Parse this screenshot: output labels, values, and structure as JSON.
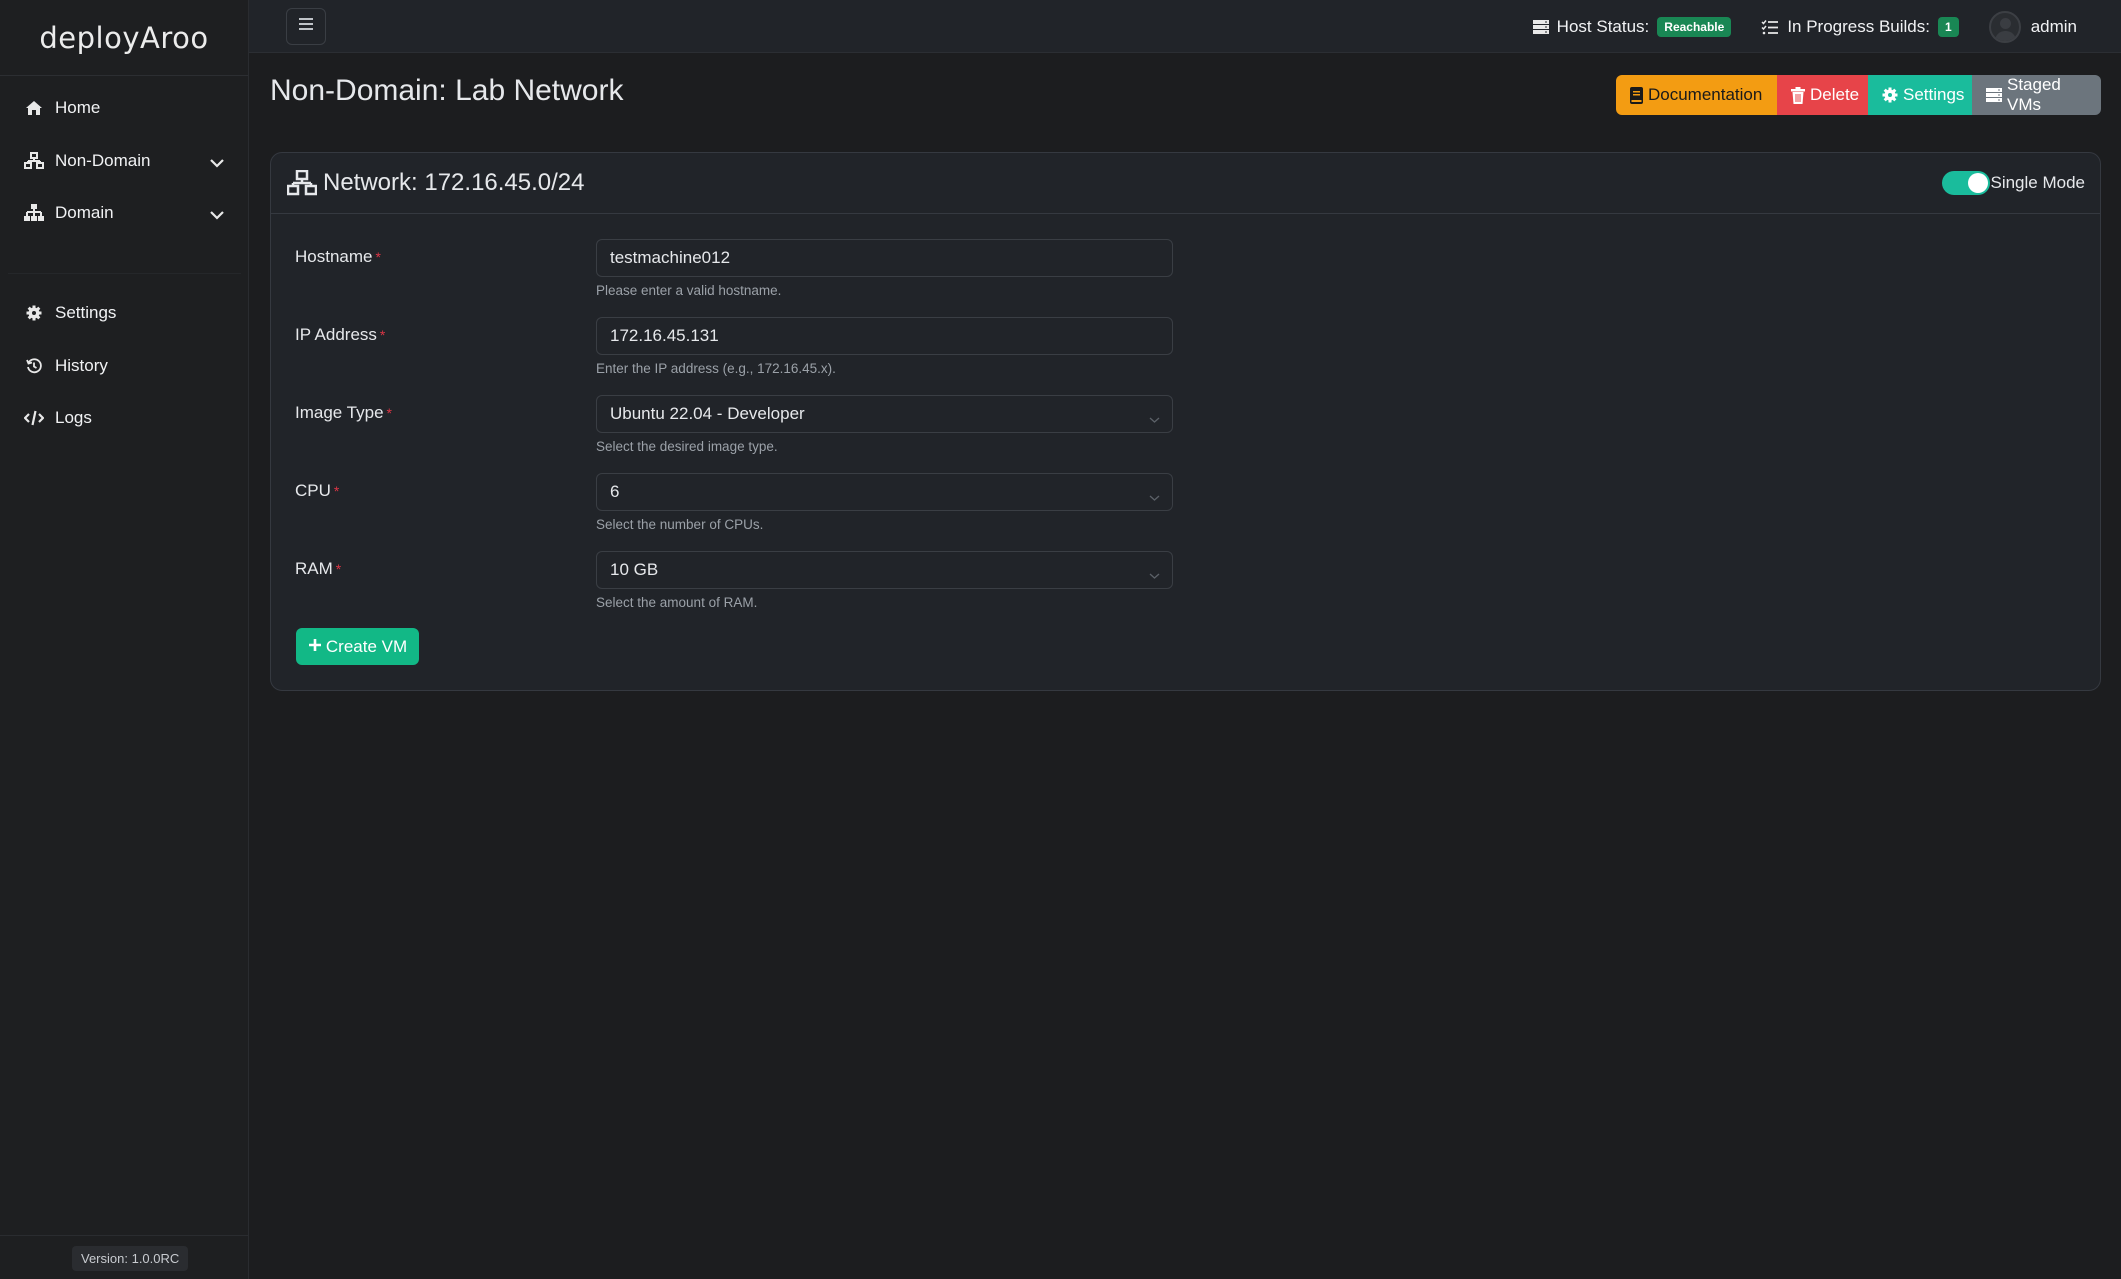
{
  "app": {
    "logo": "deployAroo",
    "version": "Version: 1.0.0RC"
  },
  "sidebar": {
    "items": [
      {
        "label": "Home",
        "icon": "home-icon"
      },
      {
        "label": "Non-Domain",
        "icon": "network-icon",
        "expandable": true
      },
      {
        "label": "Domain",
        "icon": "sitemap-icon",
        "expandable": true
      },
      {
        "label": "Settings",
        "icon": "gear-icon"
      },
      {
        "label": "History",
        "icon": "history-icon"
      },
      {
        "label": "Logs",
        "icon": "code-icon"
      }
    ]
  },
  "topbar": {
    "host_status_label": "Host Status:",
    "host_status_value": "Reachable",
    "builds_label": "In Progress Builds:",
    "builds_count": "1",
    "user": "admin"
  },
  "page": {
    "title": "Non-Domain: Lab Network",
    "actions": {
      "documentation": "Documentation",
      "delete": "Delete",
      "settings": "Settings",
      "staged_vms": "Staged VMs"
    }
  },
  "card": {
    "title": "Network: 172.16.45.0/24",
    "toggle_label": "Single Mode",
    "toggle_on": true,
    "fields": [
      {
        "label": "Hostname",
        "required": "*",
        "value": "testmachine012",
        "help": "Please enter a valid hostname.",
        "type": "text"
      },
      {
        "label": "IP Address",
        "required": "*",
        "value": "172.16.45.131",
        "help": "Enter the IP address (e.g., 172.16.45.x).",
        "type": "text"
      },
      {
        "label": "Image Type",
        "required": "*",
        "value": "Ubuntu 22.04 - Developer",
        "help": "Select the desired image type.",
        "type": "select"
      },
      {
        "label": "CPU",
        "required": "*",
        "value": "6",
        "help": "Select the number of CPUs.",
        "type": "select"
      },
      {
        "label": "RAM",
        "required": "*",
        "value": "10 GB",
        "help": "Select the amount of RAM.",
        "type": "select"
      }
    ],
    "submit_label": "Create VM"
  },
  "colors": {
    "accent_teal": "#1abc9c",
    "success_green": "#12b886",
    "badge_green": "#198754",
    "warning_orange": "#f39c12",
    "danger_red": "#e74449",
    "secondary_gray": "#6c757d"
  }
}
